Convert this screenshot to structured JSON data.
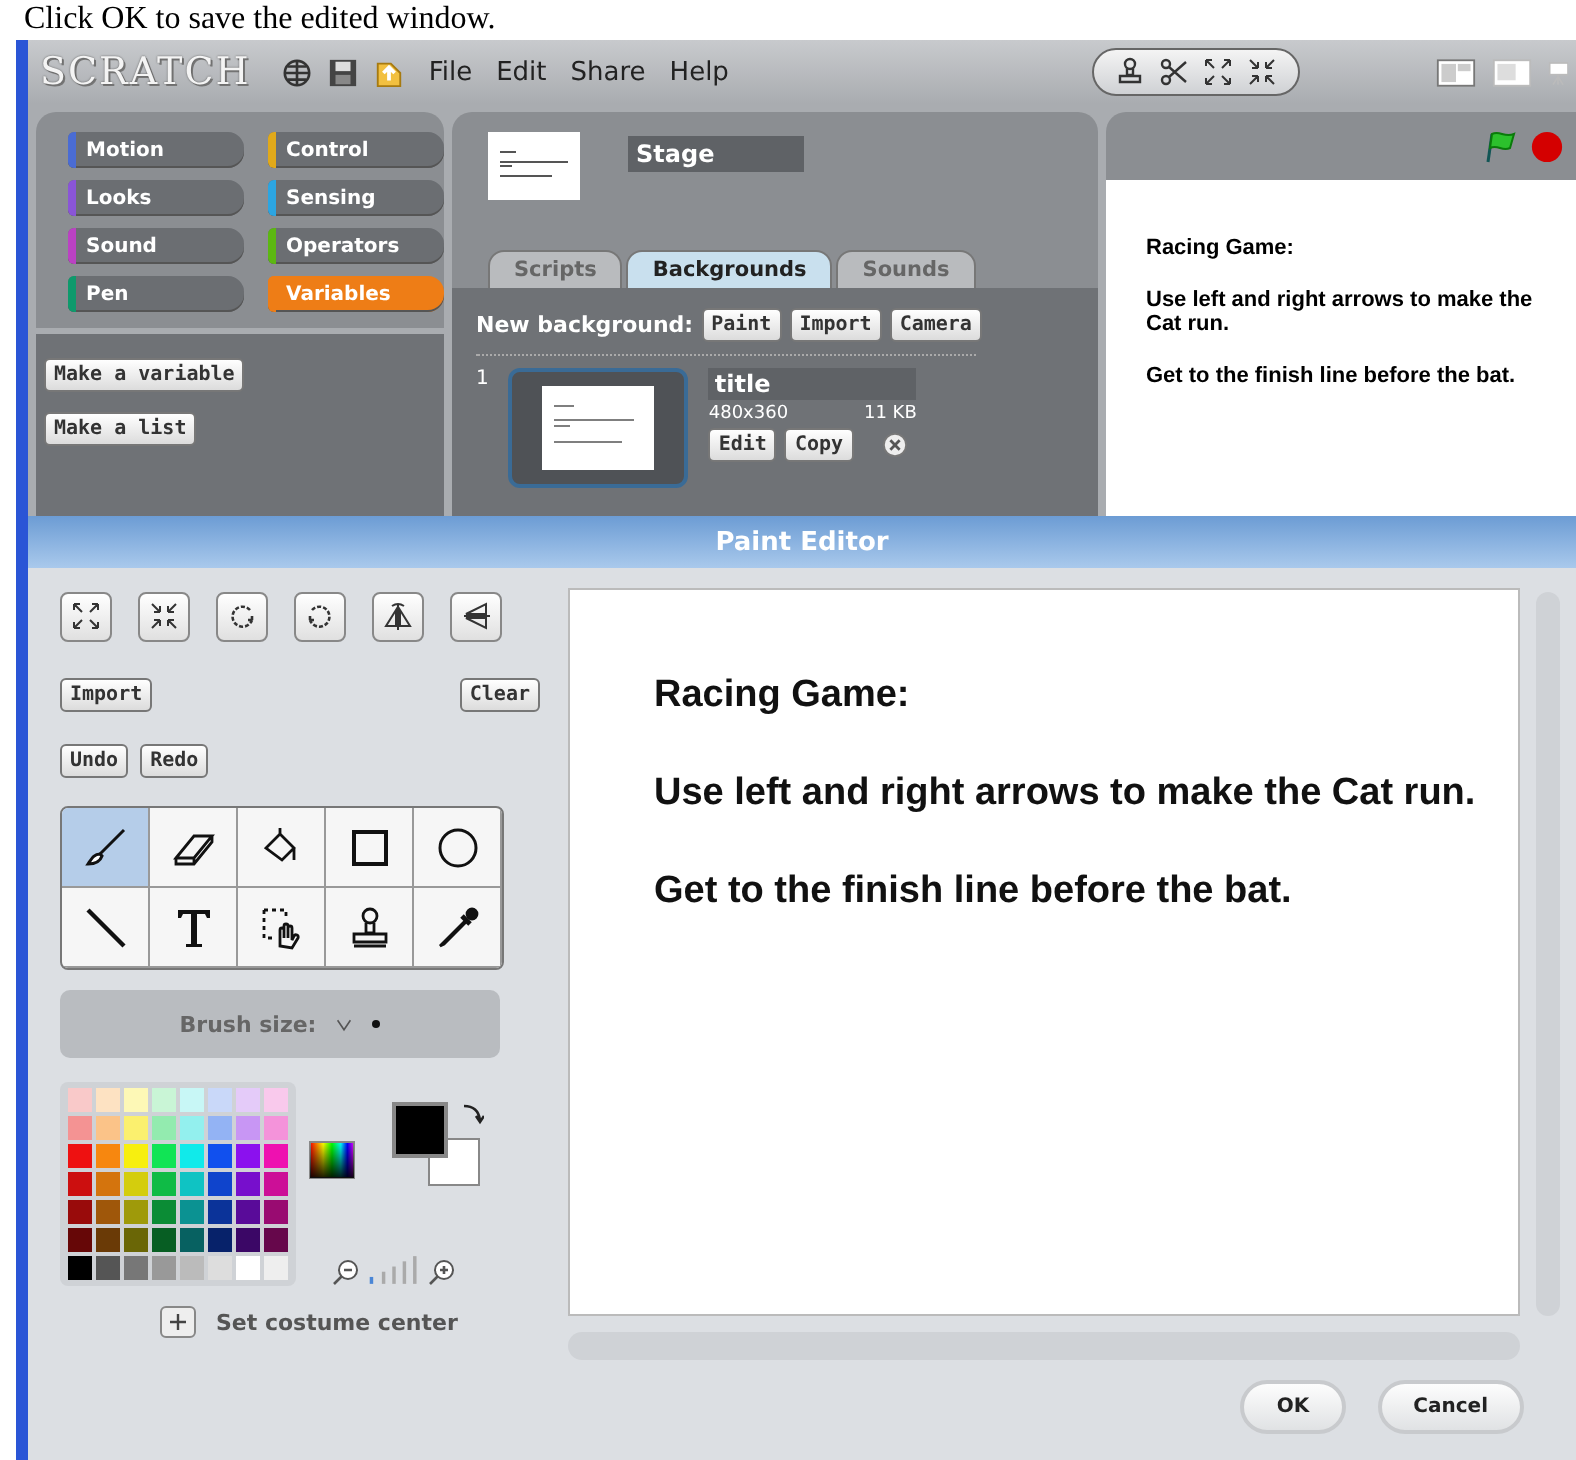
{
  "caption": "Click OK to save the edited window.",
  "app": {
    "logo": "SCRATCH",
    "menu": [
      "File",
      "Edit",
      "Share",
      "Help"
    ]
  },
  "categories": [
    {
      "label": "Motion",
      "color": "#4a6cd4",
      "selected": false
    },
    {
      "label": "Control",
      "color": "#e1a91a",
      "selected": false
    },
    {
      "label": "Looks",
      "color": "#8a55d7",
      "selected": false
    },
    {
      "label": "Sensing",
      "color": "#2ca5e2",
      "selected": false
    },
    {
      "label": "Sound",
      "color": "#bb42c3",
      "selected": false
    },
    {
      "label": "Operators",
      "color": "#5cb712",
      "selected": false
    },
    {
      "label": "Pen",
      "color": "#0e9a6c",
      "selected": false
    },
    {
      "label": "Variables",
      "color": "#ee7d16",
      "selected": true
    }
  ],
  "palette_buttons": [
    "Make a variable",
    "Make a list"
  ],
  "sprite": {
    "name": "Stage"
  },
  "tabs": [
    {
      "label": "Scripts",
      "selected": false
    },
    {
      "label": "Backgrounds",
      "selected": true
    },
    {
      "label": "Sounds",
      "selected": false
    }
  ],
  "backgrounds": {
    "label": "New background:",
    "buttons": [
      "Paint",
      "Import",
      "Camera"
    ],
    "items": [
      {
        "number": "1",
        "name": "title",
        "size": "480x360",
        "file_size": "11 KB",
        "buttons": [
          "Edit",
          "Copy"
        ]
      }
    ]
  },
  "stage": {
    "lines": [
      "Racing Game:",
      "Use left and right arrows to make the Cat run.",
      "Get to the finish line before the bat."
    ]
  },
  "paint_editor": {
    "title": "Paint Editor",
    "transforms": [
      {
        "kind": "grow"
      },
      {
        "kind": "shrink"
      },
      {
        "kind": "rotate-left"
      },
      {
        "kind": "rotate-right"
      },
      {
        "kind": "flip-horizontal"
      },
      {
        "kind": "flip-vertical"
      }
    ],
    "import": "Import",
    "clear": "Clear",
    "undo": "Undo",
    "redo": "Redo",
    "tools": [
      {
        "kind": "brush",
        "selected": true
      },
      {
        "kind": "eraser",
        "selected": false
      },
      {
        "kind": "fill",
        "selected": false
      },
      {
        "kind": "rectangle",
        "selected": false
      },
      {
        "kind": "ellipse",
        "selected": false
      },
      {
        "kind": "line",
        "selected": false
      },
      {
        "kind": "text",
        "selected": false
      },
      {
        "kind": "select",
        "selected": false
      },
      {
        "kind": "stamp",
        "selected": false
      },
      {
        "kind": "eyedropper",
        "selected": false
      }
    ],
    "brush_label": "Brush size:",
    "palette": [
      {
        "color": "#f9c9c9"
      },
      {
        "color": "#fde2c2"
      },
      {
        "color": "#fdf8b6"
      },
      {
        "color": "#c9f5d6"
      },
      {
        "color": "#c8f7f6"
      },
      {
        "color": "#c9d8f9"
      },
      {
        "color": "#e4cbf9"
      },
      {
        "color": "#f9c9ec"
      },
      {
        "color": "#f49393"
      },
      {
        "color": "#fbc388"
      },
      {
        "color": "#fbf06e"
      },
      {
        "color": "#93ebaf"
      },
      {
        "color": "#93f0ee"
      },
      {
        "color": "#93b3f4"
      },
      {
        "color": "#c896f4"
      },
      {
        "color": "#f493da"
      },
      {
        "color": "#ee1111"
      },
      {
        "color": "#f7870f"
      },
      {
        "color": "#f7ef0f"
      },
      {
        "color": "#11e455"
      },
      {
        "color": "#11eaea"
      },
      {
        "color": "#1150ee"
      },
      {
        "color": "#8b11ee"
      },
      {
        "color": "#ee11b0"
      },
      {
        "color": "#cc0f0f"
      },
      {
        "color": "#d4740d"
      },
      {
        "color": "#d4cd0d"
      },
      {
        "color": "#0fbb46"
      },
      {
        "color": "#0fc3c3"
      },
      {
        "color": "#0f44cc"
      },
      {
        "color": "#770fcc"
      },
      {
        "color": "#cc0f97"
      },
      {
        "color": "#990b0b"
      },
      {
        "color": "#9f570a"
      },
      {
        "color": "#9f9a0a"
      },
      {
        "color": "#0b8c35"
      },
      {
        "color": "#0b9292"
      },
      {
        "color": "#0b3399"
      },
      {
        "color": "#590b99"
      },
      {
        "color": "#990b71"
      },
      {
        "color": "#660707"
      },
      {
        "color": "#6a3a06"
      },
      {
        "color": "#6a6606"
      },
      {
        "color": "#075e23"
      },
      {
        "color": "#076161"
      },
      {
        "color": "#07226a"
      },
      {
        "color": "#3b0766"
      },
      {
        "color": "#66074b"
      },
      {
        "color": "#000000"
      },
      {
        "color": "#555555"
      },
      {
        "color": "#777777"
      },
      {
        "color": "#999999"
      },
      {
        "color": "#bbbbbb"
      },
      {
        "color": "#dddddd"
      },
      {
        "color": "#ffffff"
      },
      {
        "color": "#eeeeee"
      }
    ],
    "pen": {
      "color": "#000000"
    },
    "fill": {
      "color": "#ffffff"
    },
    "center_label": "Set costume center",
    "canvas_lines": [
      "Racing Game:",
      "Use left and right arrows to make the Cat run.",
      "Get to the finish line before the bat."
    ],
    "buttons": [
      "OK",
      "Cancel"
    ]
  }
}
